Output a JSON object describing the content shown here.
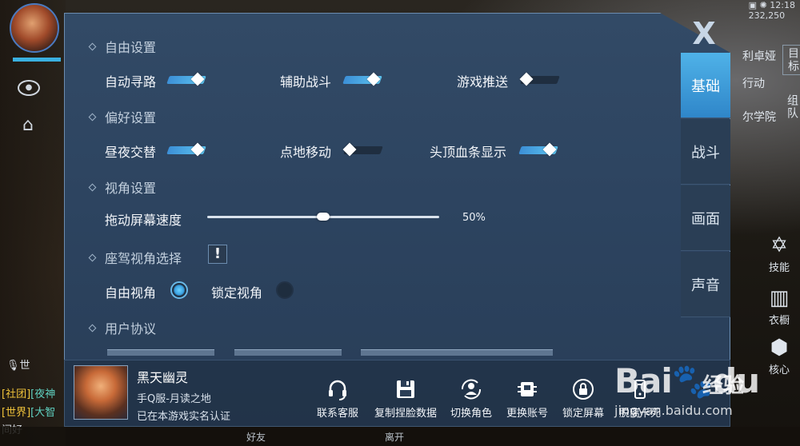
{
  "status_bar": {
    "time": "12:18",
    "ping": "232,250"
  },
  "background": {
    "chat_lines": [
      {
        "channel": "[社团]",
        "text": "[夜神"
      },
      {
        "channel": "[世界]",
        "text": "[大智"
      },
      {
        "channel": "",
        "text": "间好"
      }
    ],
    "chat_toggle": "世",
    "right_side": {
      "names": [
        "利卓娅",
        "行动",
        "尔学院"
      ],
      "vertical": [
        "目标",
        "组队"
      ],
      "skill_label": "技能",
      "wardrobe_label": "衣橱",
      "core_label": "核心"
    },
    "bottom": {
      "friends": "好友",
      "leave": "离开"
    }
  },
  "panel": {
    "close_label": "X",
    "tabs": [
      {
        "label": "基础",
        "active": true
      },
      {
        "label": "战斗",
        "active": false
      },
      {
        "label": "画面",
        "active": false
      },
      {
        "label": "声音",
        "active": false
      }
    ],
    "sections": {
      "free": "自由设置",
      "pref": "偏好设置",
      "view": "视角设置",
      "cockpit": "座驾视角选择",
      "agreement": "用户协议"
    },
    "toggles": {
      "auto_path": {
        "label": "自动寻路",
        "on": true
      },
      "assist_battle": {
        "label": "辅助战斗",
        "on": true
      },
      "game_push": {
        "label": "游戏推送",
        "on": false
      },
      "day_night": {
        "label": "昼夜交替",
        "on": true
      },
      "tap_move": {
        "label": "点地移动",
        "on": false
      },
      "head_hp": {
        "label": "头顶血条显示",
        "on": true
      }
    },
    "drag_speed": {
      "label": "拖动屏幕速度",
      "value_text": "50%",
      "value": 0.5
    },
    "info_glyph": "!",
    "cockpit_options": [
      {
        "label": "自由视角",
        "checked": true
      },
      {
        "label": "锁定视角",
        "checked": false
      }
    ]
  },
  "footer": {
    "player_name": "黑天幽灵",
    "server": "手Q服-月读之地",
    "auth": "已在本游戏实名认证",
    "actions": [
      {
        "label": "联系客服",
        "icon": "headset-icon"
      },
      {
        "label": "复制捏脸数据",
        "icon": "save-icon"
      },
      {
        "label": "切换角色",
        "icon": "switch-role-icon"
      },
      {
        "label": "更换账号",
        "icon": "change-account-icon"
      },
      {
        "label": "锁定屏幕",
        "icon": "lock-icon"
      },
      {
        "label": "脱离卡死",
        "icon": "unstuck-icon"
      }
    ]
  },
  "watermark": {
    "logo": "Bai",
    "logo_suffix": "du",
    "text": "经验",
    "url": "jingyan.baidu.com"
  },
  "colors": {
    "accent": "#3aa0e0",
    "panel": "#2d4460",
    "tab_active": "#2f86c9"
  }
}
